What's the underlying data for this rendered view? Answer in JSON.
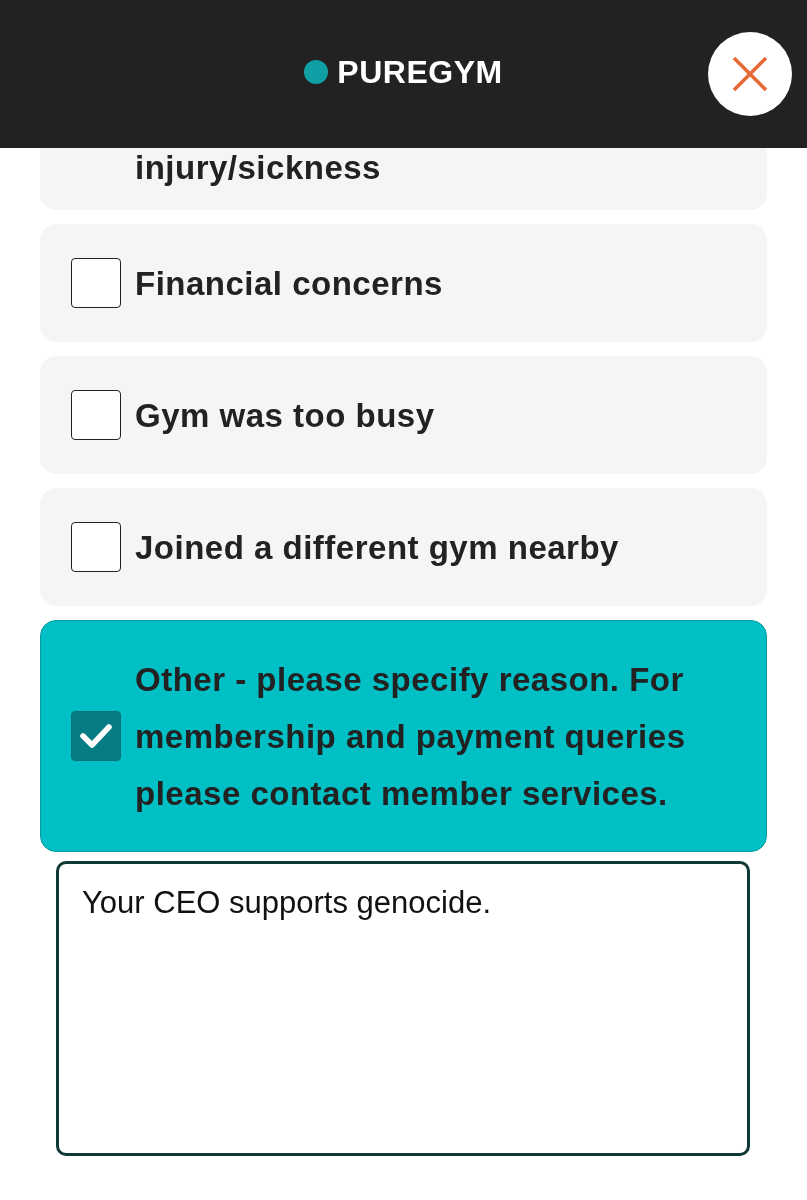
{
  "header": {
    "logo": {
      "text": "PUREGYM"
    }
  },
  "cut_off_option": {
    "label": "injury/sickness"
  },
  "options": [
    {
      "label": "Financial concerns",
      "checked": false
    },
    {
      "label": "Gym was too busy",
      "checked": false
    },
    {
      "label": "Joined a different gym nearby",
      "checked": false
    },
    {
      "label": "Other - please specify reason. For membership and payment queries please contact member services.",
      "checked": true
    }
  ],
  "reason_field": {
    "value": "Your CEO supports genocide."
  }
}
